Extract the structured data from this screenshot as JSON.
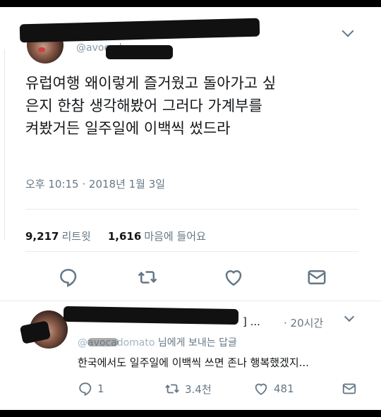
{
  "tweet": {
    "handle": "@avocadoma",
    "text_lines": [
      "유럽여행 왜이렇게 즐거웠고 돌아가고 싶",
      "은지 한참 생각해봤어 그러다 가계부를",
      "켜봤거든 일주일에 이백씩 썼드라"
    ],
    "timestamp": "오후 10:15 · 2018년 1월 3일",
    "retweets_count": "9,217",
    "retweets_label": "리트윗",
    "likes_count": "1,616",
    "likes_label": "마음에 들어요"
  },
  "reply": {
    "name_suffix": "] ...",
    "time": "· 20시간",
    "reply_to_handle": "@avocadomato",
    "reply_to_suffix": "님에게 보내는 답글",
    "text": "한국에서도 일주일에 이백씩 쓰면 존나 행복했겠지...",
    "reply_count": "1",
    "retweet_count": "3.4천",
    "like_count": "481"
  },
  "icons": {
    "reply": "reply-icon",
    "retweet": "retweet-icon",
    "like": "heart-icon",
    "dm": "envelope-icon",
    "more": "chevron-down-icon"
  },
  "colors": {
    "text": "#14171a",
    "muted": "#657786",
    "divider": "#e6ecf0",
    "link": "#9fb5c5"
  }
}
